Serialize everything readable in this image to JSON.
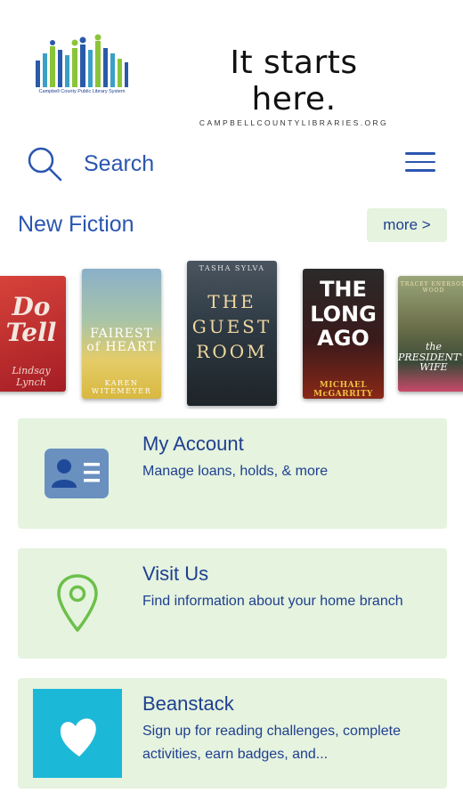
{
  "header": {
    "logo_caption": "Campbell County Public Library System",
    "tagline": "It starts here.",
    "site_url": "CAMPBELLCOUNTYLIBRARIES.ORG"
  },
  "search": {
    "label": "Search"
  },
  "new_fiction": {
    "title": "New Fiction",
    "more_label": "more >",
    "books": [
      {
        "title": "Do Tell",
        "author": "Lindsay Lynch"
      },
      {
        "title": "FAIREST of HEART",
        "author": "KAREN WITEMEYER"
      },
      {
        "title": "THE GUEST ROOM",
        "author": "TASHA SYLVA"
      },
      {
        "title": "THE LONG AGO",
        "author": "MICHAEL McGARRITY"
      },
      {
        "title": "the PRESIDENT'S WIFE",
        "author": "TRACEY ENERSON WOOD"
      }
    ]
  },
  "cards": [
    {
      "title": "My Account",
      "description": "Manage loans, holds, & more"
    },
    {
      "title": "Visit Us",
      "description": "Find information about your home branch"
    },
    {
      "title": "Beanstack",
      "description": "Sign up for reading challenges, complete activities, earn badges, and..."
    }
  ],
  "colors": {
    "accent": "#2a56b0",
    "card_bg": "#e5f3df",
    "pin_green": "#6cc04a",
    "beanstack_blue": "#1cb8d8"
  }
}
